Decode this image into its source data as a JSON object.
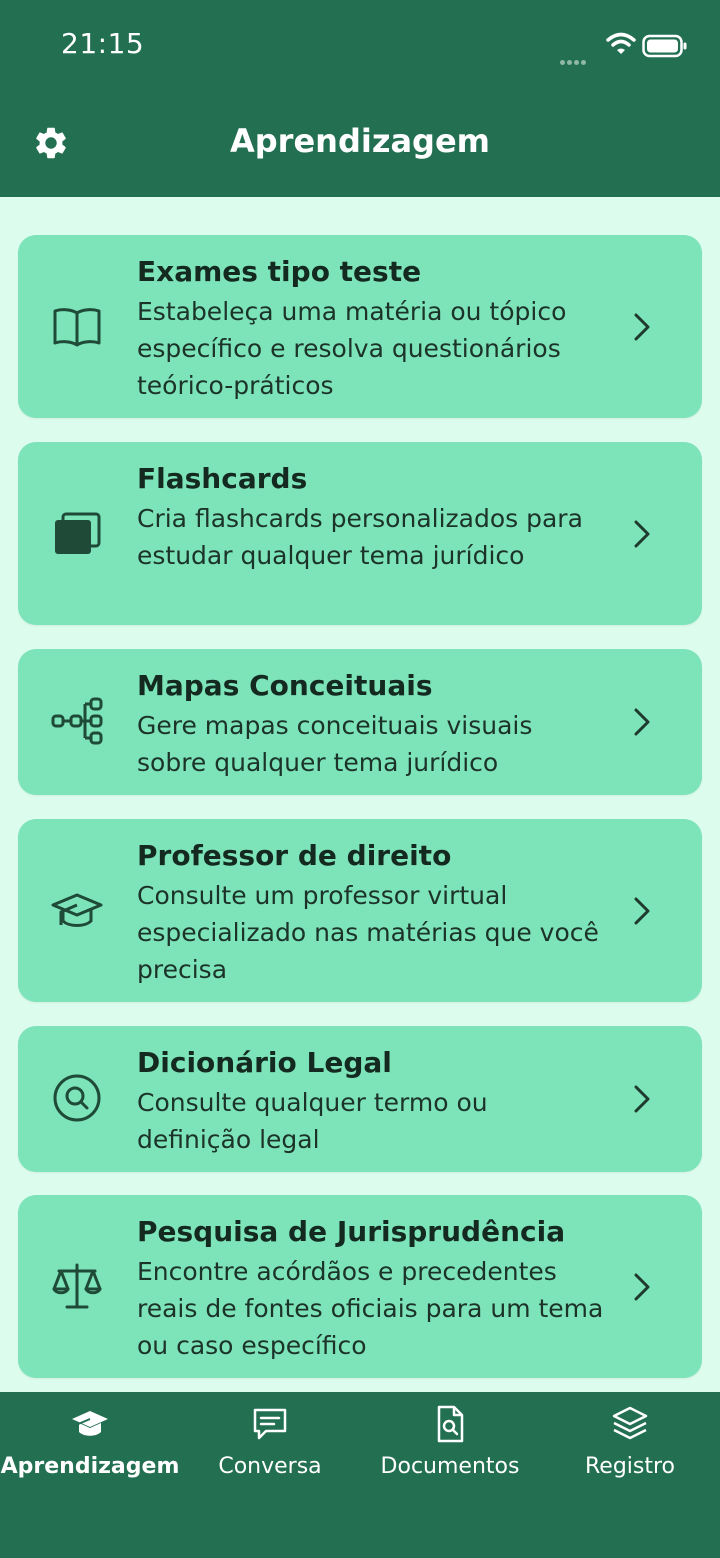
{
  "status_bar": {
    "time": "21:15"
  },
  "header": {
    "title": "Aprendizagem",
    "settings_icon": "gear-icon"
  },
  "cards": [
    {
      "title": "Exames tipo teste",
      "description": "Estabeleça uma matéria ou tópico específico e resolva questionários teórico-práticos",
      "icon": "book-icon"
    },
    {
      "title": "Flashcards",
      "description": "Cria flashcards personalizados para estudar qualquer tema jurídico",
      "icon": "cards-icon"
    },
    {
      "title": "Mapas Conceituais",
      "description": "Gere mapas conceituais visuais sobre qualquer tema jurídico",
      "icon": "mindmap-icon"
    },
    {
      "title": "Professor de direito",
      "description": "Consulte um professor virtual especializado nas matérias que você precisa",
      "icon": "graduation-cap-icon"
    },
    {
      "title": "Dicionário Legal",
      "description": "Consulte qualquer termo ou definição legal",
      "icon": "search-icon"
    },
    {
      "title": "Pesquisa de Jurisprudência",
      "description": "Encontre acórdãos e precedentes reais de fontes oficiais para um tema ou caso específico",
      "icon": "scales-icon"
    }
  ],
  "tabs": [
    {
      "label": "Aprendizagem",
      "icon": "graduation-cap-icon",
      "active": true
    },
    {
      "label": "Conversa",
      "icon": "chat-icon",
      "active": false
    },
    {
      "label": "Documentos",
      "icon": "document-search-icon",
      "active": false
    },
    {
      "label": "Registro",
      "icon": "layers-icon",
      "active": false
    }
  ],
  "colors": {
    "header": "#226f52",
    "background": "#dcfcee",
    "card": "#7de3b9",
    "text": "#142a20"
  }
}
